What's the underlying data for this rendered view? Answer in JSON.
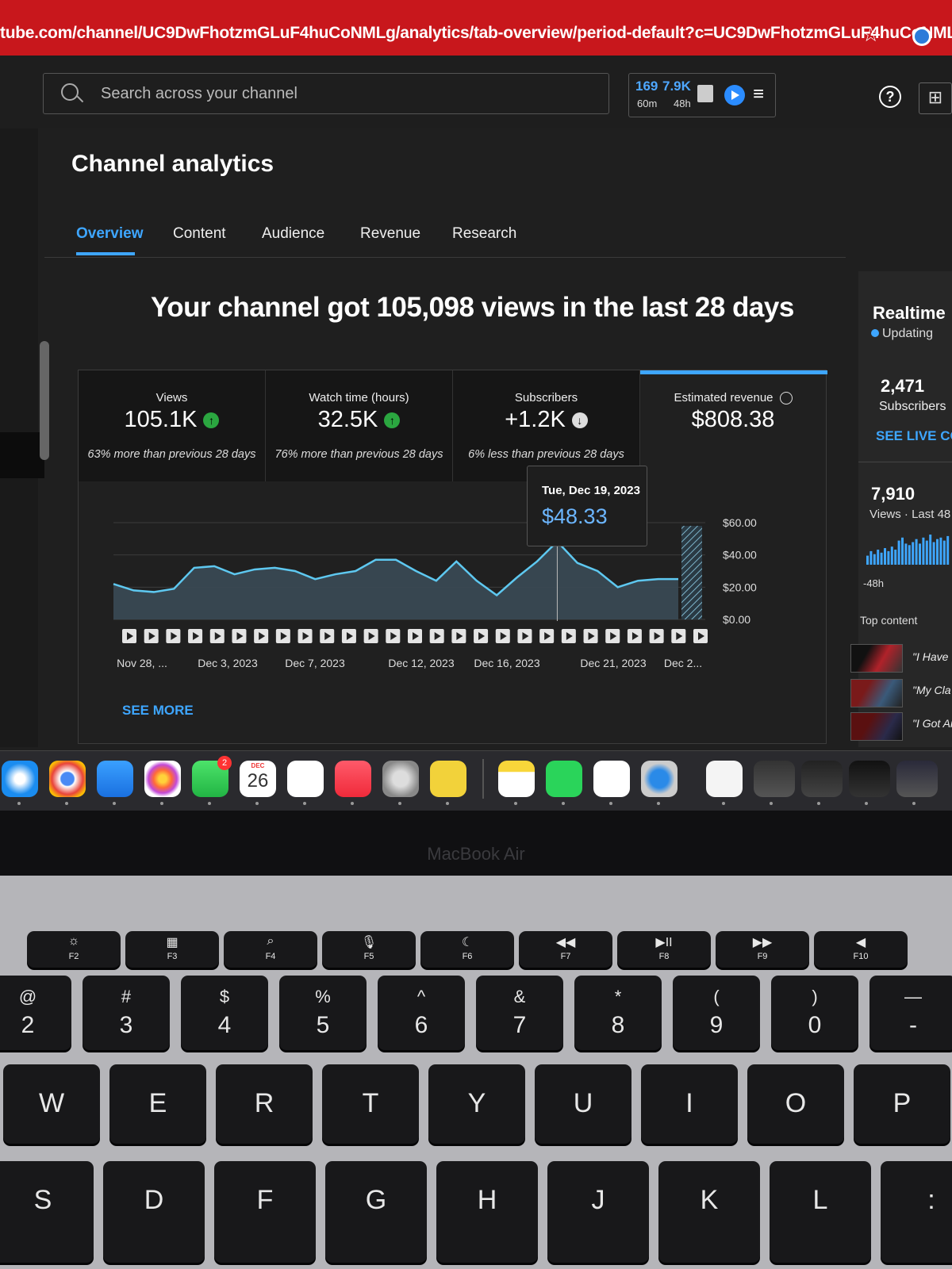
{
  "browser": {
    "url": "tube.com/channel/UC9DwFhotzmGLuF4huCoNMLg/analytics/tab-overview/period-default?c=UC9DwFhotzmGLuF4huCoNMLg"
  },
  "topbar": {
    "search_placeholder": "Search across your channel",
    "stats": [
      {
        "value": "169",
        "label": "60m"
      },
      {
        "value": "7.9K",
        "label": "48h"
      }
    ]
  },
  "page": {
    "title": "Channel analytics"
  },
  "tabs": [
    {
      "label": "Overview",
      "active": true
    },
    {
      "label": "Content"
    },
    {
      "label": "Audience"
    },
    {
      "label": "Revenue"
    },
    {
      "label": "Research"
    }
  ],
  "headline": "Your channel got 105,098 views in the last 28 days",
  "metrics": [
    {
      "label": "Views",
      "value": "105.1K",
      "trend": "up",
      "compare": "63% more than previous 28 days"
    },
    {
      "label": "Watch time (hours)",
      "value": "32.5K",
      "trend": "up",
      "compare": "76% more than previous 28 days"
    },
    {
      "label": "Subscribers",
      "value": "+1.2K",
      "trend": "down",
      "compare": "6% less than previous 28 days"
    },
    {
      "label": "Estimated revenue",
      "value": "$808.38",
      "selected": true
    }
  ],
  "tooltip": {
    "date": "Tue, Dec 19, 2023",
    "value": "$48.33"
  },
  "see_more": "SEE MORE",
  "colors": {
    "accent": "#3ea6ff",
    "up": "#2ba640",
    "line": "#5ec8f0",
    "browser_bar": "#c8171c"
  },
  "chart_data": {
    "type": "area",
    "x_tick_labels": [
      "Nov 28, ...",
      "Dec 3, 2023",
      "Dec 7, 2023",
      "Dec 12, 2023",
      "Dec 16, 2023",
      "Dec 21, 2023",
      "Dec 2..."
    ],
    "y_tick_labels": [
      "$60.00",
      "$40.00",
      "$20.00",
      "$0.00"
    ],
    "ylim": [
      0,
      60
    ],
    "series": [
      {
        "values": [
          22,
          18,
          17,
          19,
          32,
          33,
          28,
          31,
          32,
          30,
          25,
          28,
          30,
          37,
          37,
          30,
          24,
          36,
          24,
          15,
          26,
          36,
          48.33,
          35,
          30,
          20,
          24,
          25,
          25
        ]
      }
    ],
    "highlight_index": 22,
    "partial_last_bar_value": 58,
    "video_markers": 27,
    "grid": true
  },
  "realtime": {
    "title": "Realtime",
    "status": "Updating",
    "subscribers_value": "2,471",
    "subscribers_label": "Subscribers",
    "see_live": "SEE LIVE CO",
    "views_value": "7,910",
    "views_label": "Views · Last 48",
    "range_label": "-48h",
    "top_content_label": "Top content",
    "top_items": [
      "\"I Have",
      "\"My Cla",
      "\"I Got An"
    ],
    "hourly_bars": [
      0.3,
      0.45,
      0.35,
      0.5,
      0.4,
      0.55,
      0.45,
      0.6,
      0.5,
      0.8,
      0.9,
      0.7,
      0.65,
      0.75,
      0.85,
      0.7,
      0.9,
      0.8,
      1.0,
      0.75,
      0.85,
      0.9,
      0.8,
      0.95
    ]
  },
  "dock": {
    "calendar_month": "DEC",
    "calendar_day": "26",
    "facetime_badge": "2"
  },
  "laptop": {
    "model": "MacBook Air",
    "fkeys": [
      {
        "top": "☼",
        "bot": "F2"
      },
      {
        "top": "▦",
        "bot": "F3"
      },
      {
        "top": "⌕",
        "bot": "F4"
      },
      {
        "top": "🎙",
        "bot": "F5"
      },
      {
        "top": "☾",
        "bot": "F6"
      },
      {
        "top": "◀◀",
        "bot": "F7"
      },
      {
        "top": "▶II",
        "bot": "F8"
      },
      {
        "top": "▶▶",
        "bot": "F9"
      },
      {
        "top": "◀",
        "bot": "F10"
      }
    ],
    "numkeys": [
      {
        "sym": "@",
        "num": "2"
      },
      {
        "sym": "#",
        "num": "3"
      },
      {
        "sym": "$",
        "num": "4"
      },
      {
        "sym": "%",
        "num": "5"
      },
      {
        "sym": "^",
        "num": "6"
      },
      {
        "sym": "&",
        "num": "7"
      },
      {
        "sym": "*",
        "num": "8"
      },
      {
        "sym": "(",
        "num": "9"
      },
      {
        "sym": ")",
        "num": "0"
      },
      {
        "sym": "—",
        "num": "-"
      }
    ],
    "row_q": [
      "W",
      "E",
      "R",
      "T",
      "Y",
      "U",
      "I",
      "O",
      "P"
    ],
    "row_a": [
      "S",
      "D",
      "F",
      "G",
      "H",
      "J",
      "K",
      "L",
      ":"
    ]
  }
}
